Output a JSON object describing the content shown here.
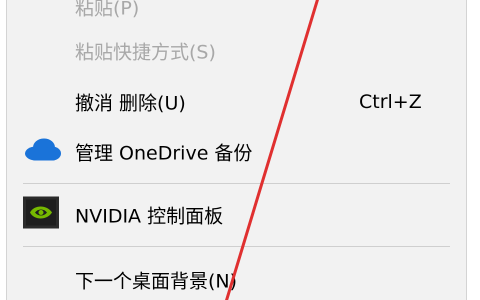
{
  "context_menu": {
    "items": [
      {
        "label": "粘贴(P)",
        "shortcut": "",
        "disabled": true
      },
      {
        "label": "粘贴快捷方式(S)",
        "shortcut": "",
        "disabled": true
      },
      {
        "label": "撤消 删除(U)",
        "shortcut": "Ctrl+Z",
        "disabled": false
      },
      {
        "label": "管理 OneDrive 备份",
        "icon": "onedrive-cloud-icon",
        "disabled": false
      },
      {
        "label": "NVIDIA 控制面板",
        "icon": "nvidia-logo-icon",
        "disabled": false
      },
      {
        "label": "下一个桌面背景(N)",
        "shortcut": "",
        "disabled": false
      }
    ]
  },
  "colors": {
    "menu_background": "#f2f2f2",
    "disabled_text": "#a8a8a8",
    "annotation_line": "#e03030",
    "onedrive_blue": "#1a73d9",
    "nvidia_green": "#76b900"
  }
}
